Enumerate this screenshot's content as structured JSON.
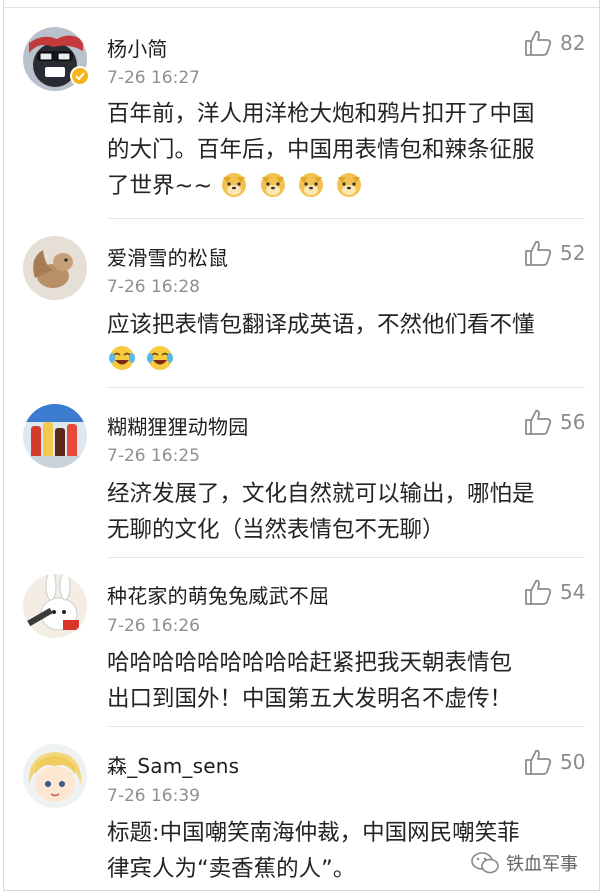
{
  "comments": [
    {
      "name": "杨小简",
      "time": "7-26 16:27",
      "likes": "82",
      "verified": true,
      "lines": [
        "百年前，洋人用洋枪大炮和鸦片扣开了中国",
        "的大门。百年后，中国用表情包和辣条征服",
        "了世界~~"
      ],
      "emoji": "doge-emoji x4"
    },
    {
      "name": "爱滑雪的松鼠",
      "time": "7-26 16:28",
      "likes": "52",
      "lines": [
        "应该把表情包翻译成英语，不然他们看不懂"
      ],
      "emoji": "laugh-cry-emoji x2"
    },
    {
      "name": "糊糊狸狸动物园",
      "time": "7-26 16:25",
      "likes": "56",
      "lines": [
        "经济发展了，文化自然就可以输出，哪怕是",
        "无聊的文化（当然表情包不无聊）"
      ]
    },
    {
      "name": "种花家的萌兔兔威武不屈",
      "time": "7-26 16:26",
      "likes": "54",
      "lines": [
        "哈哈哈哈哈哈哈哈哈赶紧把我天朝表情包",
        "出口到国外！中国第五大发明名不虚传！"
      ]
    },
    {
      "name": "森_Sam_sens",
      "time": "7-26 16:39",
      "likes": "50",
      "lines": [
        "标题:中国嘲笑南海仲裁，中国网民嘲笑菲",
        "律宾人为“卖香蕉的人”。"
      ]
    }
  ],
  "watermark": "铁血军事",
  "colors": {
    "like_icon": "#8c8c8c",
    "verified_badge": "#f6b417",
    "separator": "#e6e6e6"
  }
}
